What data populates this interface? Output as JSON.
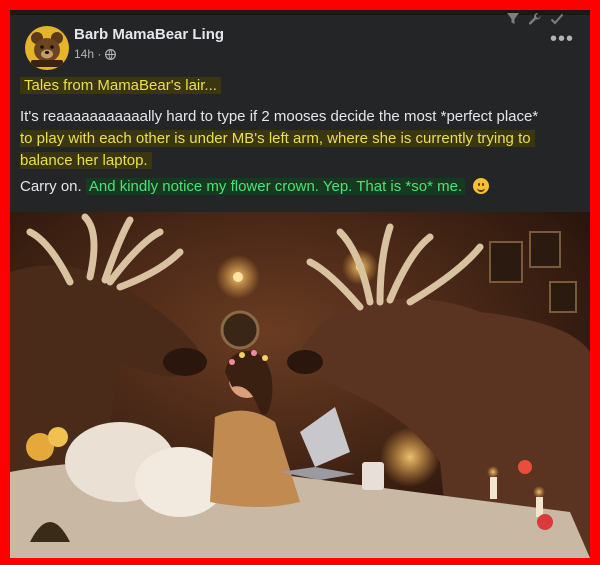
{
  "post": {
    "author": "Barb MamaBear Ling",
    "time": "14h ·",
    "avatar_caption": "MamaBear",
    "more": "•••",
    "line1": "Tales from MamaBear's lair...",
    "p2_plain": "It's reaaaaaaaaaaally hard to type if 2 mooses decide the most *perfect place*",
    "p2_hl_line1": "to play with each other is under MB's left arm, where she is currently trying to",
    "p2_hl_line2": "balance her laptop.",
    "p3_plain": "Carry on.",
    "p3_green": "And kindly notice my flower crown.  Yep.  That is *so* me.",
    "emoji": "smiling-face-emoji"
  },
  "icons": [
    "filter-icon",
    "wrench-icon",
    "check-icon",
    "globe-icon",
    "more-options-icon"
  ],
  "colors": {
    "frame": "#ff0000",
    "card": "#242526",
    "highlight_yellow": "#ecdf4d",
    "highlight_green": "#4ee077"
  }
}
